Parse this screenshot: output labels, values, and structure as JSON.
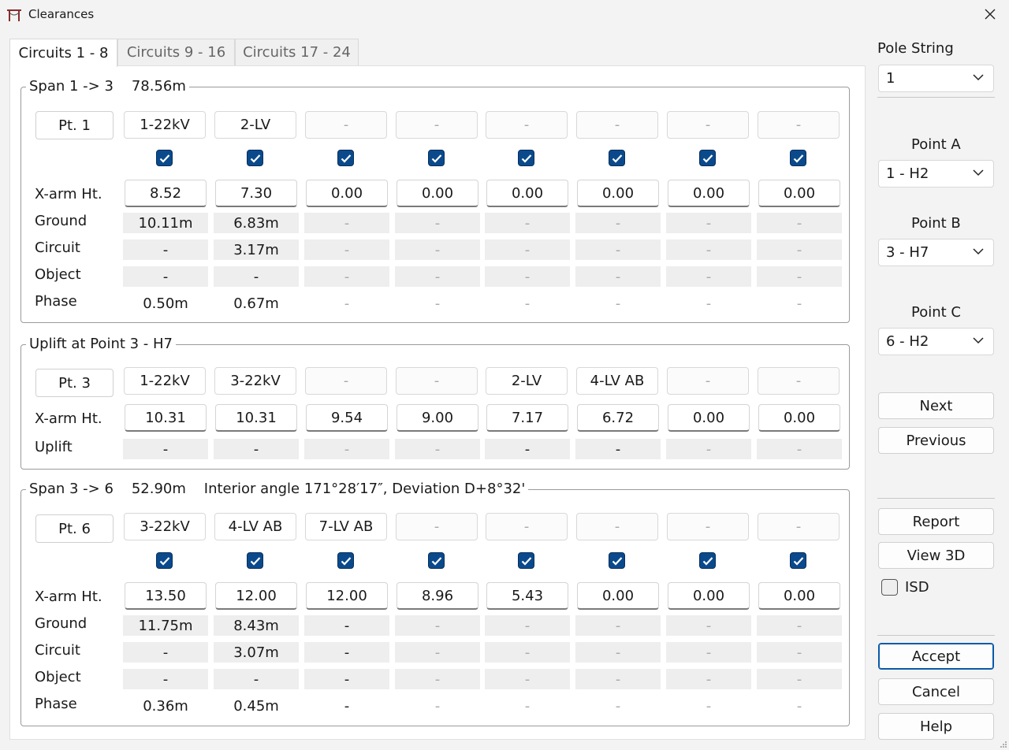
{
  "window": {
    "title": "Clearances"
  },
  "tabs": [
    "Circuits 1 - 8",
    "Circuits 9 - 16",
    "Circuits 17 - 24"
  ],
  "sections": [
    {
      "legend": "Span 1 -> 3    78.56m",
      "point": "Pt. 1",
      "circuits": [
        "1-22kV",
        "2-LV",
        "-",
        "-",
        "-",
        "-",
        "-",
        "-"
      ],
      "checked": [
        true,
        true,
        true,
        true,
        true,
        true,
        true,
        true
      ],
      "rows": [
        {
          "label": "X-arm Ht.",
          "kind": "input",
          "values": [
            "8.52",
            "7.30",
            "0.00",
            "0.00",
            "0.00",
            "0.00",
            "0.00",
            "0.00"
          ]
        },
        {
          "label": "Ground",
          "kind": "readonly",
          "values": [
            "10.11m",
            "6.83m",
            "-",
            "-",
            "-",
            "-",
            "-",
            "-"
          ]
        },
        {
          "label": "Circuit",
          "kind": "readonly",
          "values": [
            "-",
            "3.17m",
            "-",
            "-",
            "-",
            "-",
            "-",
            "-"
          ]
        },
        {
          "label": "Object",
          "kind": "readonly",
          "values": [
            "-",
            "-",
            "-",
            "-",
            "-",
            "-",
            "-",
            "-"
          ]
        },
        {
          "label": "Phase",
          "kind": "text",
          "values": [
            "0.50m",
            "0.67m",
            "-",
            "-",
            "-",
            "-",
            "-",
            "-"
          ]
        }
      ]
    },
    {
      "legend": "Uplift at Point 3 - H7",
      "point": "Pt. 3",
      "circuits": [
        "1-22kV",
        "3-22kV",
        "-",
        "-",
        "2-LV",
        "4-LV AB",
        "-",
        "-"
      ],
      "rows": [
        {
          "label": "X-arm Ht.",
          "kind": "input",
          "values": [
            "10.31",
            "10.31",
            "9.54",
            "9.00",
            "7.17",
            "6.72",
            "0.00",
            "0.00"
          ]
        },
        {
          "label": "Uplift",
          "kind": "readonly",
          "values": [
            "-",
            "-",
            "-",
            "-",
            "-",
            "-",
            "-",
            "-"
          ]
        }
      ]
    },
    {
      "legend": "Span 3 -> 6    52.90m    Interior angle 171°28′17″, Deviation D+8°32'",
      "point": "Pt. 6",
      "circuits": [
        "3-22kV",
        "4-LV AB",
        "7-LV AB",
        "-",
        "-",
        "-",
        "-",
        "-"
      ],
      "checked": [
        true,
        true,
        true,
        true,
        true,
        true,
        true,
        true
      ],
      "rows": [
        {
          "label": "X-arm Ht.",
          "kind": "input",
          "values": [
            "13.50",
            "12.00",
            "12.00",
            "8.96",
            "5.43",
            "0.00",
            "0.00",
            "0.00"
          ]
        },
        {
          "label": "Ground",
          "kind": "readonly",
          "values": [
            "11.75m",
            "8.43m",
            "-",
            "-",
            "-",
            "-",
            "-",
            "-"
          ]
        },
        {
          "label": "Circuit",
          "kind": "readonly",
          "values": [
            "-",
            "3.07m",
            "-",
            "-",
            "-",
            "-",
            "-",
            "-"
          ]
        },
        {
          "label": "Object",
          "kind": "readonly",
          "values": [
            "-",
            "-",
            "-",
            "-",
            "-",
            "-",
            "-",
            "-"
          ]
        },
        {
          "label": "Phase",
          "kind": "text",
          "values": [
            "0.36m",
            "0.45m",
            "-",
            "-",
            "-",
            "-",
            "-",
            "-"
          ]
        }
      ]
    }
  ],
  "side": {
    "pole_string": {
      "label": "Pole String",
      "value": "1"
    },
    "point_a": {
      "label": "Point A",
      "value": "1 - H2"
    },
    "point_b": {
      "label": "Point B",
      "value": "3 - H7"
    },
    "point_c": {
      "label": "Point C",
      "value": "6 - H2"
    },
    "buttons": {
      "next": "Next",
      "previous": "Previous",
      "report": "Report",
      "view3d": "View 3D",
      "accept": "Accept",
      "cancel": "Cancel",
      "help": "Help"
    },
    "isd": {
      "label": "ISD",
      "checked": false
    }
  },
  "colors": {
    "checkbox": "#0a4a8c",
    "readonly_bg": "#eeeeee",
    "default_button_border": "#0a5aa8"
  }
}
